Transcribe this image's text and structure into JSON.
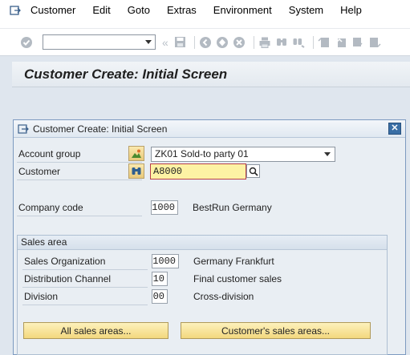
{
  "menu": {
    "items": [
      "Customer",
      "Edit",
      "Goto",
      "Extras",
      "Environment",
      "System",
      "Help"
    ]
  },
  "toolbar": {
    "command_field": "",
    "icons": [
      "enter-icon",
      "save-icon",
      "back-icon",
      "exit-icon",
      "cancel-icon",
      "print-icon",
      "find-icon",
      "find-next-icon",
      "first-page-icon",
      "previous-page-icon",
      "next-page-icon",
      "last-page-icon"
    ]
  },
  "screen": {
    "title": "Customer Create: Initial Screen"
  },
  "dialog": {
    "title": "Customer Create: Initial Screen",
    "close_symbol": "✕",
    "account_group": {
      "label": "Account group",
      "value": "ZK01 Sold-to party 01"
    },
    "customer": {
      "label": "Customer",
      "value": "A8000"
    },
    "company_code": {
      "label": "Company code",
      "value": "1000",
      "description": "BestRun Germany"
    },
    "sales_area": {
      "title": "Sales area",
      "sales_org": {
        "label": "Sales Organization",
        "value": "1000",
        "description": "Germany Frankfurt"
      },
      "distribution_channel": {
        "label": "Distribution Channel",
        "value": "10",
        "description": "Final customer sales"
      },
      "division": {
        "label": "Division",
        "value": "00",
        "description": "Cross-division"
      },
      "all_sales_areas_button": "All sales areas...",
      "customers_sales_areas_button": "Customer's sales areas..."
    }
  },
  "colors": {
    "accent_blue": "#3a6ea5",
    "required_border": "#b8404a",
    "input_yellow": "#fdf2a4"
  }
}
